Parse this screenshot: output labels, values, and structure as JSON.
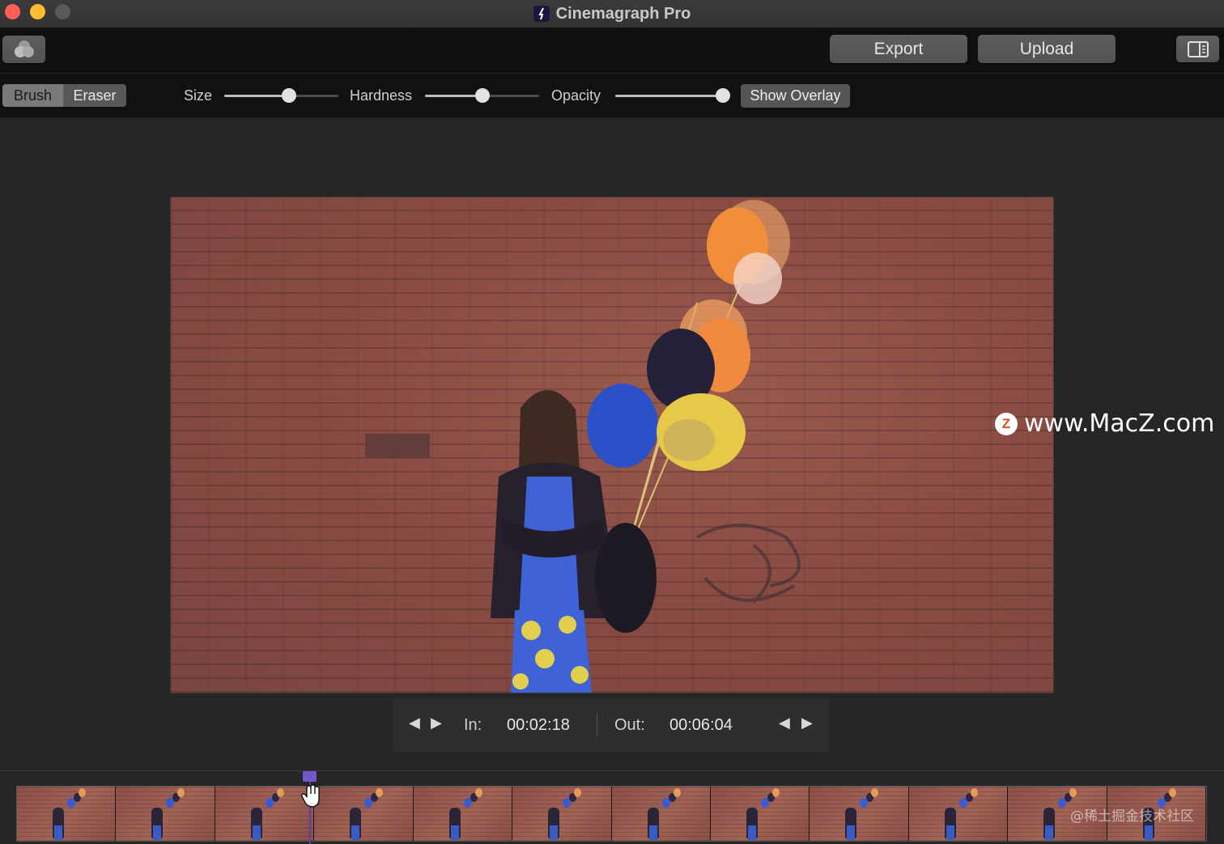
{
  "window": {
    "title": "Cinemagraph Pro"
  },
  "toolbar": {
    "layers_icon": "layers-icon",
    "export_label": "Export",
    "upload_label": "Upload",
    "sidebar_icon": "sidebar-toggle-icon"
  },
  "brush_bar": {
    "modes": [
      "Brush",
      "Eraser"
    ],
    "selected_mode": "Brush",
    "size_label": "Size",
    "size_value": 0.57,
    "hardness_label": "Hardness",
    "hardness_value": 0.5,
    "opacity_label": "Opacity",
    "opacity_value": 0.94,
    "show_overlay_label": "Show Overlay"
  },
  "watermark": {
    "text": "www.MacZ.com",
    "logo": "Z"
  },
  "inout": {
    "in_label": "In:",
    "in_time": "00:02:18",
    "out_label": "Out:",
    "out_time": "00:06:04"
  },
  "timeline": {
    "frame_count": 12,
    "footer_watermark": "@稀土掘金技术社区"
  },
  "colors": {
    "accent_playhead": "#7257c9",
    "close": "#fe5f57",
    "minimize": "#febc2e"
  }
}
